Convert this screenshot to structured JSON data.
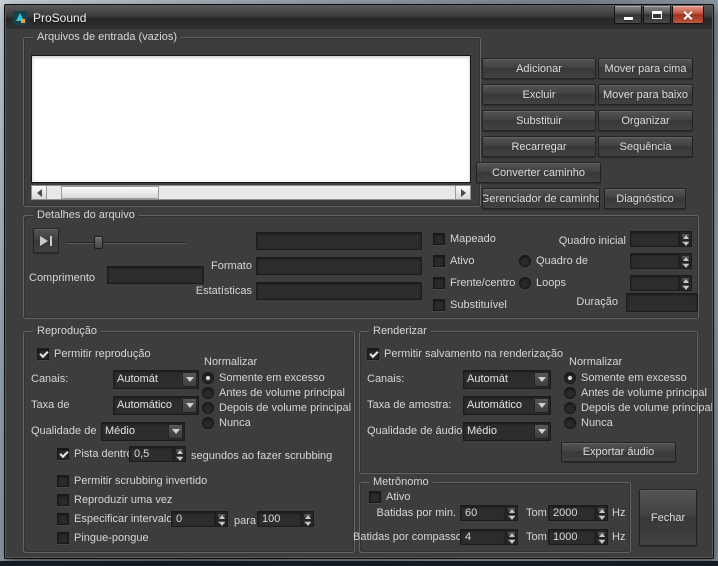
{
  "colors": {
    "window_bg": "#3d3d3d",
    "text": "#d6d6d6",
    "field_bg": "#2d2d2d",
    "listbox_bg": "#ffffff",
    "close_button_red": "#c4503a"
  },
  "window": {
    "title": "ProSound"
  },
  "file_list": {
    "group_label": "Arquivos de entrada (vazios)",
    "items": [],
    "buttons": {
      "add": "Adicionar",
      "move_up": "Mover para cima",
      "remove": "Excluir",
      "move_down": "Mover para baixo",
      "replace": "Substituir",
      "organize": "Organizar",
      "reload": "Recarregar",
      "sequence": "Sequência",
      "convert_path": "Converter caminho",
      "path_manager": "Gerenciador de caminho",
      "diagnostics": "Diagnóstico"
    }
  },
  "details": {
    "group_label": "Detalhes do arquivo",
    "length_label": "Comprimento",
    "format_label": "Formato",
    "statistics_label": "Estatísticas",
    "name_value": "",
    "length_value": "",
    "format_value": "",
    "statistics_value": "",
    "mapped_label": "Mapeado",
    "active_label": "Ativo",
    "front_center_label": "Frente/centro",
    "replaceable_label": "Substituível",
    "start_frame_label": "Quadro inicial",
    "frame_of_label": "Quadro de",
    "loops_label": "Loops",
    "duration_label": "Duração",
    "start_frame_value": "",
    "frame_of_value": "",
    "loops_value": "",
    "duration_value": ""
  },
  "playback": {
    "group_label": "Reprodução",
    "enable_label": "Permitir reprodução",
    "enable_checked": true,
    "normalize_label": "Normalizar",
    "channels_label": "Canais:",
    "channels_value": "Automát",
    "sample_rate_label": "Taxa de",
    "sample_rate_value": "Automático",
    "quality_label": "Qualidade de",
    "quality_value": "Médio",
    "normalize_options": [
      "Somente em excesso",
      "Antes de volume principal",
      "Depois de volume principal",
      "Nunca"
    ],
    "normalize_selected": "Somente em excesso",
    "scrub_label": "Pista dentro",
    "scrub_checked": true,
    "scrub_value": "0,5",
    "scrub_suffix": "segundos ao fazer scrubbing",
    "invert_scrub_label": "Permitir scrubbing invertido",
    "play_once_label": "Reproduzir uma vez",
    "range_label": "Especificar intervalo",
    "range_from_value": "0",
    "range_to_word": "para",
    "range_to_value": "100",
    "ping_pong_label": "Pingue-pongue"
  },
  "render": {
    "group_label": "Renderizar",
    "enable_label": "Permitir salvamento na renderização",
    "enable_checked": true,
    "normalize_label": "Normalizar",
    "channels_label": "Canais:",
    "channels_value": "Automát",
    "sample_rate_label": "Taxa de amostra:",
    "sample_rate_value": "Automático",
    "quality_label": "Qualidade de áudio:",
    "quality_value": "Médio",
    "normalize_options": [
      "Somente em excesso",
      "Antes de volume principal",
      "Depois de volume principal",
      "Nunca"
    ],
    "normalize_selected": "Somente em excesso",
    "export_label": "Exportar áudio"
  },
  "metronome": {
    "group_label": "Metrônomo",
    "active_label": "Ativo",
    "active_checked": false,
    "bpm_label": "Batidas por min.",
    "bpm_value": "60",
    "tone_high_label": "Tom",
    "tone_high_value": "2000",
    "tone_high_unit": "Hz",
    "beats_label": "Batidas por compasso",
    "beats_value": "4",
    "tone_low_label": "Tom",
    "tone_low_value": "1000",
    "tone_low_unit": "Hz"
  },
  "close_label": "Fechar"
}
